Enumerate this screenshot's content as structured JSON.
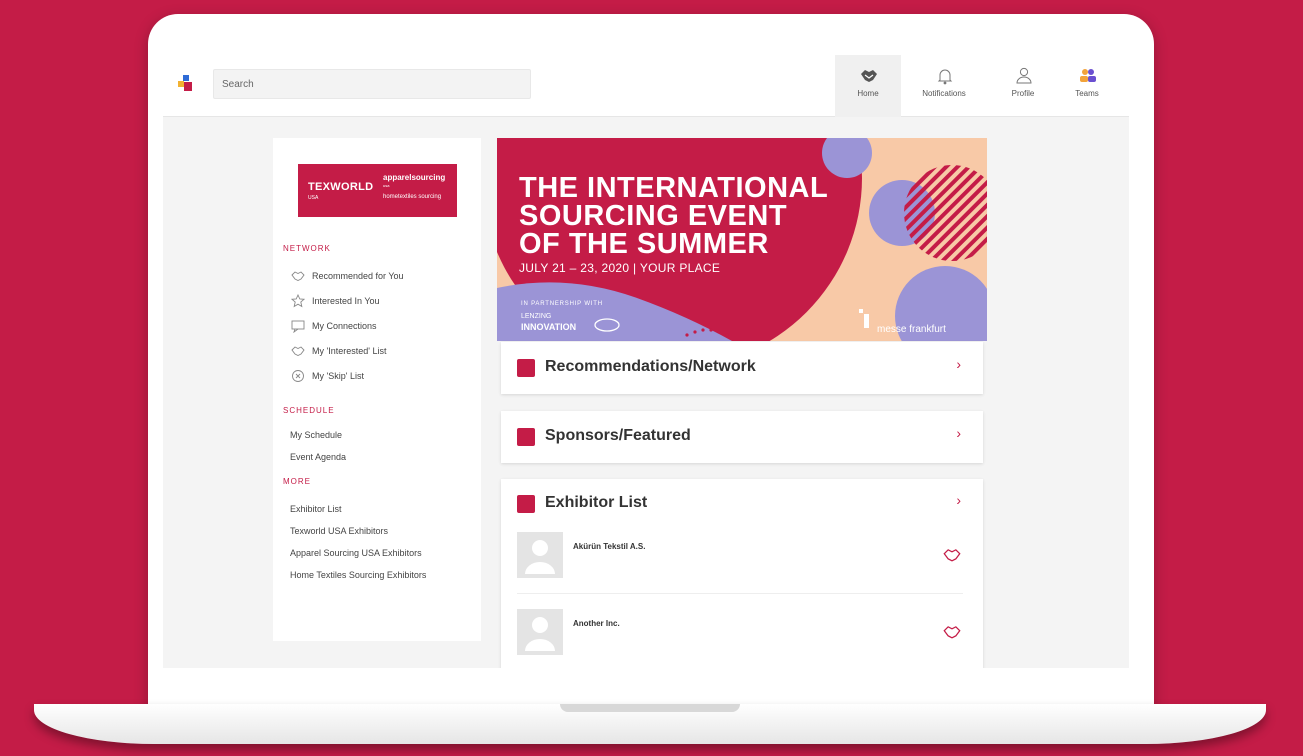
{
  "colors": {
    "brand": "#c41c47",
    "banner_peach": "#f8c9a7",
    "banner_lilac": "#9b94d6"
  },
  "search": {
    "placeholder": "Search"
  },
  "nav": [
    {
      "label": "Home",
      "icon": "handshake-icon",
      "active": true
    },
    {
      "label": "Notifications",
      "icon": "bell-icon"
    },
    {
      "label": "Profile",
      "icon": "user-icon"
    },
    {
      "label": "Teams",
      "icon": "team-icon"
    }
  ],
  "brand": {
    "texworld": "TEXWORLD",
    "texworld_sub": "USA",
    "apparel": "apparelsourcing",
    "apparel_sub": "usa",
    "home_textiles": "hometextiles sourcing"
  },
  "sidebar": {
    "network_title": "NETWORK",
    "network_items": [
      {
        "label": "Recommended for You",
        "icon": "handshake-icon"
      },
      {
        "label": "Interested In You",
        "icon": "star-icon"
      },
      {
        "label": "My Connections",
        "icon": "chat-icon"
      },
      {
        "label": "My 'Interested' List",
        "icon": "handshake-icon"
      },
      {
        "label": "My 'Skip' List",
        "icon": "close-circle-icon"
      }
    ],
    "schedule_title": "SCHEDULE",
    "schedule_items": [
      "My Schedule",
      "Event Agenda"
    ],
    "more_title": "MORE",
    "more_items": [
      "Exhibitor List",
      "Texworld USA Exhibitors",
      "Apparel Sourcing USA Exhibitors",
      "Home Textiles Sourcing Exhibitors"
    ]
  },
  "banner": {
    "line1": "THE INTERNATIONAL",
    "line2": "SOURCING EVENT",
    "line3": "OF THE SUMMER",
    "date": "JULY 21 – 23, 2020 | YOUR PLACE",
    "partnership": "IN PARTNERSHIP WITH",
    "lenzing": "LENZING",
    "innovation": "INNOVATION",
    "messe": "messe frankfurt"
  },
  "cards": {
    "recommendations": "Recommendations/Network",
    "sponsors": "Sponsors/Featured",
    "exhibitors": "Exhibitor List",
    "chevron": "›"
  },
  "exhibitors": [
    {
      "name": "Akürün Tekstil A.S."
    },
    {
      "name": "Another Inc."
    }
  ]
}
